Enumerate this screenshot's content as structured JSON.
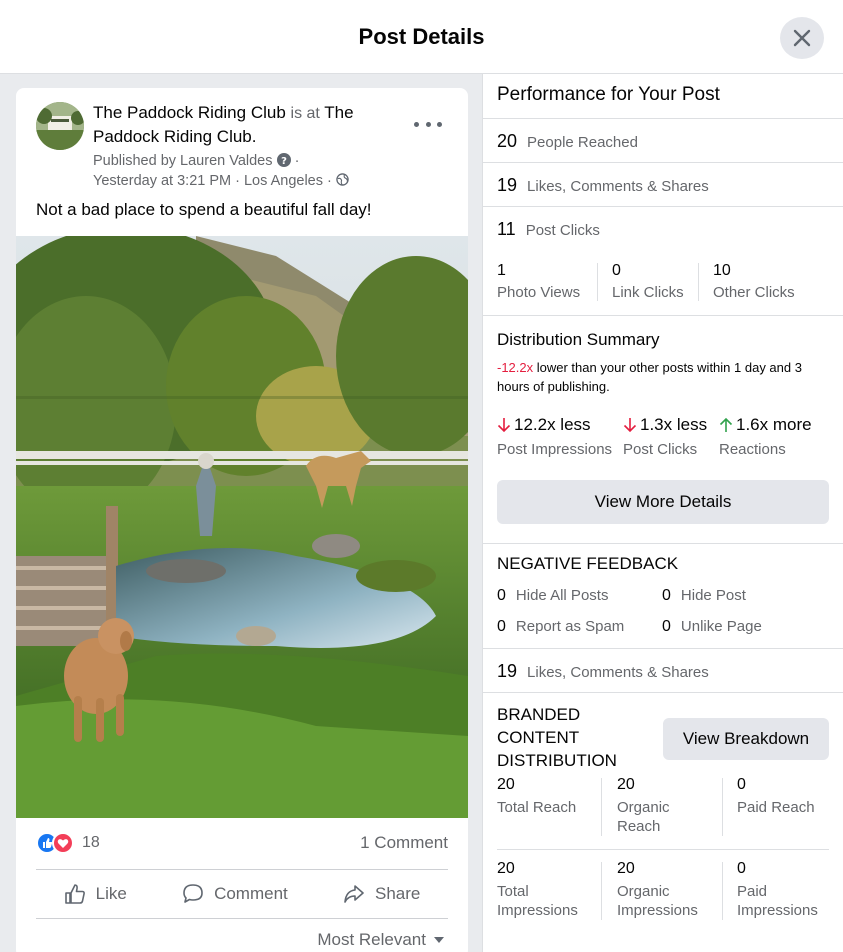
{
  "header": {
    "title": "Post Details"
  },
  "post": {
    "page_name": "The Paddock Riding Club",
    "is_at": "is at",
    "location_name": "The Paddock Riding Club",
    "published_by": "Published by Lauren Valdes",
    "time": "Yesterday at 3:21 PM · Los Angeles ·",
    "text": "Not a bad place to spend a beautiful fall day!",
    "reaction_count": "18",
    "comment_count": "1 Comment",
    "actions": {
      "like": "Like",
      "comment": "Comment",
      "share": "Share"
    },
    "sort_label": "Most Relevant"
  },
  "performance": {
    "title": "Performance for Your Post",
    "people_reached": {
      "value": "20",
      "label": "People Reached"
    },
    "engagement": {
      "value": "19",
      "label": "Likes, Comments & Shares"
    },
    "post_clicks": {
      "value": "11",
      "label": "Post Clicks"
    },
    "clicks_breakdown": [
      {
        "value": "1",
        "label": "Photo Views"
      },
      {
        "value": "0",
        "label": "Link Clicks"
      },
      {
        "value": "10",
        "label": "Other Clicks"
      }
    ]
  },
  "distribution": {
    "title": "Distribution Summary",
    "highlight": "-12.2x",
    "desc": " lower than your other posts within 1 day and 3 hours of publishing.",
    "metrics": [
      {
        "value": "12.2x less",
        "label": "Post Impressions",
        "direction": "down"
      },
      {
        "value": "1.3x less",
        "label": "Post Clicks",
        "direction": "down"
      },
      {
        "value": "1.6x more",
        "label": "Reactions",
        "direction": "up"
      }
    ],
    "button": "View More Details"
  },
  "negative_feedback": {
    "title": "NEGATIVE FEEDBACK",
    "items": [
      {
        "value": "0",
        "label": "Hide All Posts"
      },
      {
        "value": "0",
        "label": "Hide Post"
      },
      {
        "value": "0",
        "label": "Report as Spam"
      },
      {
        "value": "0",
        "label": "Unlike Page"
      }
    ]
  },
  "engagement2": {
    "value": "19",
    "label": "Likes, Comments & Shares"
  },
  "branded": {
    "title_lines": [
      "BRANDED",
      "CONTENT",
      "DISTRIBUTION"
    ],
    "button": "View Breakdown",
    "reach": [
      {
        "value": "20",
        "label_lines": [
          "Total Reach"
        ]
      },
      {
        "value": "20",
        "label_lines": [
          "Organic",
          "Reach"
        ]
      },
      {
        "value": "0",
        "label_lines": [
          "Paid Reach"
        ]
      }
    ],
    "impressions": [
      {
        "value": "20",
        "label_lines": [
          "Total",
          "Impressions"
        ]
      },
      {
        "value": "20",
        "label_lines": [
          "Organic",
          "Impressions"
        ]
      },
      {
        "value": "0",
        "label_lines": [
          "Paid",
          "Impressions"
        ]
      }
    ]
  },
  "colors": {
    "like_blue": "#1877f2",
    "love_red": "#f33e58",
    "negative": "#e41e3f",
    "positive": "#31a24c"
  }
}
